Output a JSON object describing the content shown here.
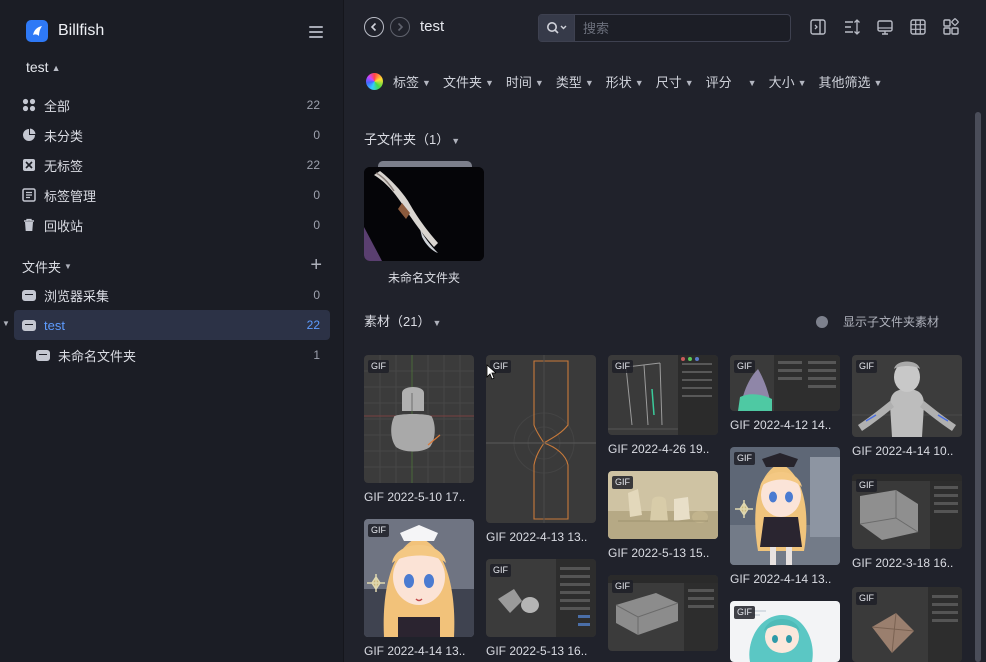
{
  "app": {
    "name": "Billfish",
    "library": "test",
    "library_arrows": "▲▼"
  },
  "colors": {
    "accent": "#5e9cff",
    "brand": "#2e79f6",
    "sidebar_bg": "#1b1d25",
    "main_bg": "#20222b"
  },
  "sidebar": {
    "nav": [
      {
        "label": "全部",
        "count": "22",
        "icon": "grid-dots-icon"
      },
      {
        "label": "未分类",
        "count": "0",
        "icon": "pie-icon"
      },
      {
        "label": "无标签",
        "count": "22",
        "icon": "no-tag-icon"
      },
      {
        "label": "标签管理",
        "count": "0",
        "icon": "tag-manage-icon"
      },
      {
        "label": "回收站",
        "count": "0",
        "icon": "trash-icon"
      }
    ],
    "folders_label": "文件夹",
    "folders": [
      {
        "label": "浏览器采集",
        "count": "0"
      },
      {
        "label": "test",
        "count": "22"
      },
      {
        "label": "未命名文件夹",
        "count": "1"
      }
    ]
  },
  "header": {
    "title": "test",
    "search_placeholder": "搜索"
  },
  "filters": [
    "标签",
    "文件夹",
    "时间",
    "类型",
    "形状",
    "尺寸",
    "评分",
    "大小",
    "其他筛选"
  ],
  "subfolders": {
    "label": "子文件夹（1）",
    "items": [
      {
        "name": "未命名文件夹"
      }
    ]
  },
  "assets": {
    "label": "素材（21）",
    "show_sub_label": "显示子文件夹素材",
    "badge": "GIF",
    "items": [
      {
        "caption": "GIF 2022-5-10 17..",
        "col": 0
      },
      {
        "caption": "GIF 2022-4-14 13..",
        "col": 0
      },
      {
        "caption": "GIF 2022-4-13 13..",
        "col": 1
      },
      {
        "caption": "GIF 2022-5-13 16..",
        "col": 1
      },
      {
        "caption": "GIF 2022-4-26 19..",
        "col": 2
      },
      {
        "caption": "GIF 2022-5-13 15..",
        "col": 2
      },
      {
        "caption": "",
        "col": 2
      },
      {
        "caption": "GIF 2022-4-12 14..",
        "col": 3
      },
      {
        "caption": "GIF 2022-4-14 13..",
        "col": 3
      },
      {
        "caption": "",
        "col": 3
      },
      {
        "caption": "GIF 2022-4-14 10..",
        "col": 4
      },
      {
        "caption": "GIF 2022-3-18 16..",
        "col": 4
      },
      {
        "caption": "",
        "col": 4
      }
    ]
  }
}
